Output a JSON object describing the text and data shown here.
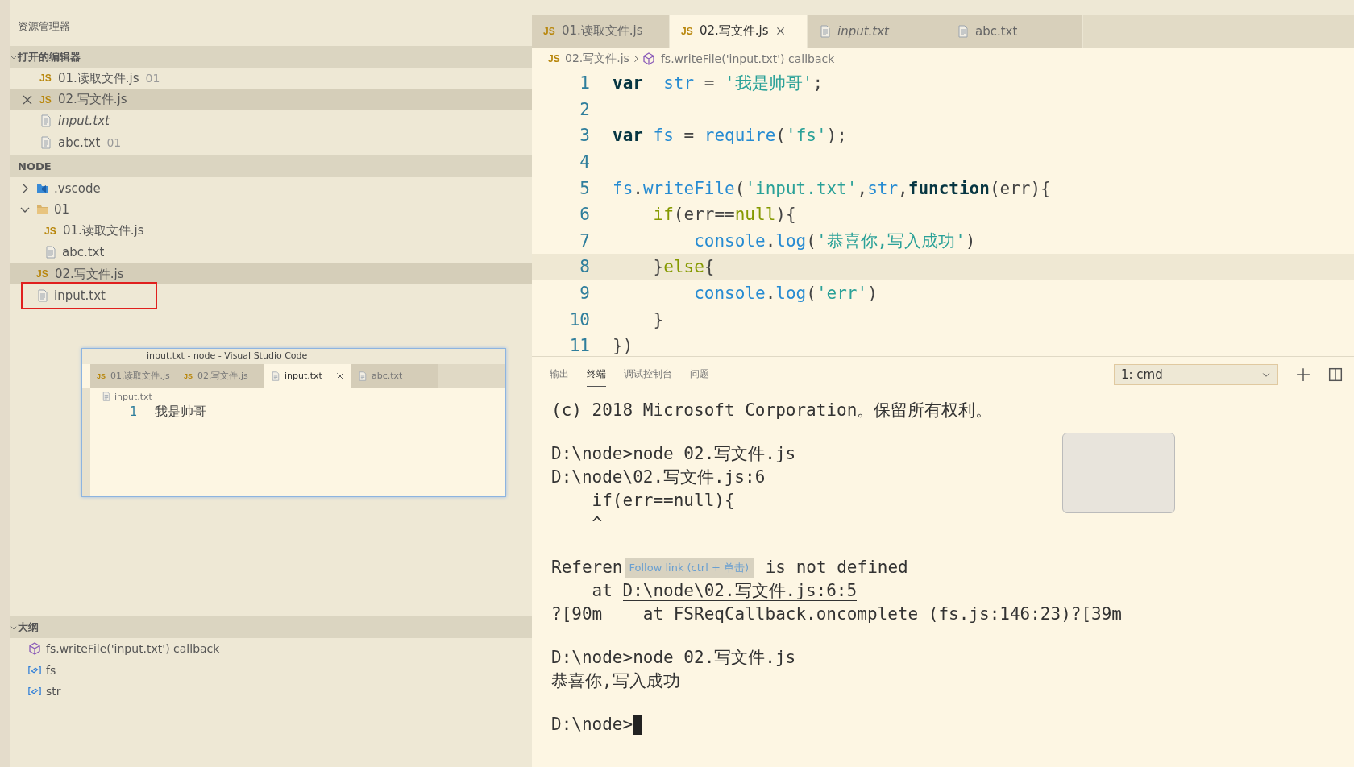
{
  "sidebar": {
    "title": "资源管理器",
    "open_editors": {
      "header": "打开的编辑器",
      "expanded": true,
      "items": [
        {
          "kind": "js",
          "icon_label": "JS",
          "name": "01.读取文件.js",
          "hint": "01",
          "italic": false,
          "selected": false
        },
        {
          "kind": "js",
          "icon_label": "JS",
          "name": "02.写文件.js",
          "italic": false,
          "selected": true
        },
        {
          "kind": "txt",
          "name": "input.txt",
          "italic": true,
          "selected": false
        },
        {
          "kind": "txt",
          "name": "abc.txt",
          "hint": "01",
          "italic": false,
          "selected": false
        }
      ]
    },
    "folder": {
      "header": "NODE",
      "items": [
        {
          "kind": "vscode",
          "name": ".vscode",
          "expanded": false,
          "selected": false,
          "highlighted": false
        },
        {
          "kind": "folder",
          "name": "01",
          "expanded": true,
          "selected": false,
          "highlighted": false,
          "children": [
            {
              "kind": "js",
              "icon_label": "JS",
              "name": "01.读取文件.js",
              "selected": false,
              "highlighted": false
            },
            {
              "kind": "txt",
              "name": "abc.txt",
              "selected": false,
              "highlighted": false
            }
          ]
        },
        {
          "kind": "js",
          "icon_label": "JS",
          "name": "02.写文件.js",
          "selected": true,
          "highlighted": false
        },
        {
          "kind": "txt",
          "name": "input.txt",
          "selected": false,
          "highlighted": true
        }
      ]
    },
    "outline": {
      "header": "大纲",
      "expanded": true,
      "items": [
        {
          "kind": "callback",
          "name": "fs.writeFile('input.txt') callback"
        },
        {
          "kind": "variable",
          "name": "fs"
        },
        {
          "kind": "variable",
          "name": "str"
        }
      ]
    }
  },
  "preview_window": {
    "title": "input.txt - node - Visual Studio Code",
    "tabs": [
      {
        "kind": "js",
        "icon_label": "JS",
        "label": "01.读取文件.js",
        "selected": false
      },
      {
        "kind": "js",
        "icon_label": "JS",
        "label": "02.写文件.js",
        "selected": false
      },
      {
        "kind": "txt",
        "label": "input.txt",
        "selected": true
      },
      {
        "kind": "txt",
        "label": "abc.txt",
        "selected": false
      }
    ],
    "breadcrumb": "input.txt",
    "lines": [
      {
        "number": "1",
        "text": "我是帅哥"
      }
    ]
  },
  "editor": {
    "tabs": [
      {
        "kind": "js",
        "icon_label": "JS",
        "label": "01.读取文件.js",
        "italic": false,
        "selected": false
      },
      {
        "kind": "js",
        "icon_label": "JS",
        "label": "02.写文件.js",
        "italic": false,
        "selected": true
      },
      {
        "kind": "txt",
        "label": "input.txt",
        "italic": true,
        "selected": false
      },
      {
        "kind": "txt",
        "label": "abc.txt",
        "italic": false,
        "selected": false
      }
    ],
    "breadcrumb": {
      "icon_label": "JS",
      "file": "02.写文件.js",
      "symbol": "fs.writeFile('input.txt') callback"
    },
    "lines": [
      {
        "number": "1",
        "current": false,
        "tokens": [
          {
            "kind": "kw",
            "text": "var  "
          },
          {
            "kind": "var",
            "text": "str"
          },
          {
            "kind": "plain",
            "text": " = "
          },
          {
            "kind": "str",
            "text": "'我是帅哥'"
          },
          {
            "kind": "plain",
            "text": ";"
          }
        ]
      },
      {
        "number": "2",
        "current": false
      },
      {
        "number": "3",
        "current": false,
        "tokens": [
          {
            "kind": "kw",
            "text": "var "
          },
          {
            "kind": "var",
            "text": "fs"
          },
          {
            "kind": "plain",
            "text": " = "
          },
          {
            "kind": "fn",
            "text": "require"
          },
          {
            "kind": "plain",
            "text": "("
          },
          {
            "kind": "str",
            "text": "'fs'"
          },
          {
            "kind": "plain",
            "text": ");"
          }
        ]
      },
      {
        "number": "4",
        "current": false
      },
      {
        "number": "5",
        "current": false,
        "tokens": [
          {
            "kind": "var",
            "text": "fs"
          },
          {
            "kind": "plain",
            "text": "."
          },
          {
            "kind": "fn",
            "text": "writeFile"
          },
          {
            "kind": "plain",
            "text": "("
          },
          {
            "kind": "str",
            "text": "'input.txt'"
          },
          {
            "kind": "plain",
            "text": ","
          },
          {
            "kind": "var",
            "text": "str"
          },
          {
            "kind": "plain",
            "text": ","
          },
          {
            "kind": "kw",
            "text": "function"
          },
          {
            "kind": "plain",
            "text": "(err){"
          }
        ]
      },
      {
        "number": "6",
        "current": false,
        "tokens": [
          {
            "kind": "ctl",
            "text": "    if"
          },
          {
            "kind": "plain",
            "text": "(err=="
          },
          {
            "kind": "ctl",
            "text": "null"
          },
          {
            "kind": "plain",
            "text": "){"
          }
        ]
      },
      {
        "number": "7",
        "current": false,
        "tokens": [
          {
            "kind": "var",
            "text": "        console"
          },
          {
            "kind": "plain",
            "text": "."
          },
          {
            "kind": "fn",
            "text": "log"
          },
          {
            "kind": "plain",
            "text": "("
          },
          {
            "kind": "str",
            "text": "'恭喜你,写入成功'"
          },
          {
            "kind": "plain",
            "text": ")"
          }
        ]
      },
      {
        "number": "8",
        "current": true,
        "tokens": [
          {
            "kind": "plain",
            "text": "    }"
          },
          {
            "kind": "ctl",
            "text": "else"
          },
          {
            "kind": "plain",
            "text": "{"
          }
        ]
      },
      {
        "number": "9",
        "current": false,
        "tokens": [
          {
            "kind": "var",
            "text": "        console"
          },
          {
            "kind": "plain",
            "text": "."
          },
          {
            "kind": "fn",
            "text": "log"
          },
          {
            "kind": "plain",
            "text": "("
          },
          {
            "kind": "str",
            "text": "'err'"
          },
          {
            "kind": "plain",
            "text": ")"
          }
        ]
      },
      {
        "number": "10",
        "current": false,
        "tokens": [
          {
            "kind": "plain",
            "text": "    }"
          }
        ]
      },
      {
        "number": "11",
        "current": false,
        "tokens": [
          {
            "kind": "plain",
            "text": "})"
          }
        ]
      }
    ]
  },
  "panel": {
    "tabs": [
      {
        "label": "输出",
        "selected": false
      },
      {
        "label": "终端",
        "selected": true
      },
      {
        "label": "调试控制台",
        "selected": false
      },
      {
        "label": "问题",
        "selected": false
      }
    ],
    "terminal_select": "1: cmd",
    "terminal_blocks": [
      [
        [
          {
            "kind": "text",
            "text": "(c) 2018 Microsoft Corporation。保留所有权利。"
          }
        ]
      ],
      [
        [
          {
            "kind": "text",
            "text": "D:\\node>node 02.写文件.js"
          }
        ],
        [
          {
            "kind": "text",
            "text": "D:\\node\\02.写文件.js:6"
          }
        ],
        [
          {
            "kind": "text",
            "text": "    if(err==null){"
          }
        ],
        [
          {
            "kind": "text",
            "text": "    ^"
          }
        ]
      ],
      [
        [
          {
            "kind": "text",
            "text": "Referen"
          },
          {
            "kind": "tooltip",
            "text": "Follow link (ctrl + 单击)"
          },
          {
            "kind": "text",
            "text": " is not defined"
          }
        ],
        [
          {
            "kind": "text",
            "text": "    at "
          },
          {
            "kind": "link",
            "text": "D:\\node\\02.写文件.js:6:5"
          }
        ],
        [
          {
            "kind": "text",
            "text": "?[90m    at FSReqCallback.oncomplete (fs.js:146:23)?[39m"
          }
        ]
      ],
      [
        [
          {
            "kind": "text",
            "text": "D:\\node>node 02.写文件.js"
          }
        ],
        [
          {
            "kind": "text",
            "text": "恭喜你,写入成功"
          }
        ]
      ],
      [
        [
          {
            "kind": "text",
            "text": "D:\\node>"
          },
          {
            "kind": "cursor"
          }
        ]
      ]
    ]
  }
}
